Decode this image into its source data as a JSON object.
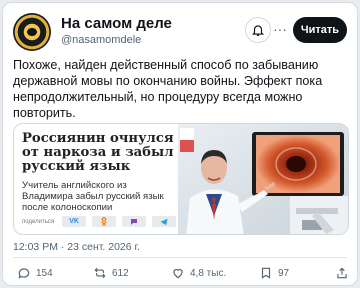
{
  "author": {
    "name": "На самом деле",
    "handle": "@nasamomdele",
    "avatar": "avatar-logo"
  },
  "header": {
    "follow_label": "Читать",
    "more_label": "···"
  },
  "tweet": {
    "text": "Похоже, найден действенный способ по забыванию державной мовы по окончанию войны. Эффект пока непродолжительный, но процедуру всегда можно повторить."
  },
  "embed": {
    "title": "Россиянин очнулся от наркоза и забыл русский язык",
    "subtitle": "Учитель английского из Владимира забыл русский язык после колоноскопии",
    "share_label": "поделиться",
    "share_buttons": [
      "vk-icon",
      "ok-icon",
      "chat-icon",
      "telegram-icon"
    ]
  },
  "timestamp": "12:03 PM · 23 сент. 2026 г.",
  "metrics": {
    "replies": "154",
    "retweets": "612",
    "likes": "4,8 тыс.",
    "bookmarks": "97"
  },
  "colors": {
    "accent": "#0f1419",
    "muted": "#536471",
    "border": "#cfd9de"
  }
}
